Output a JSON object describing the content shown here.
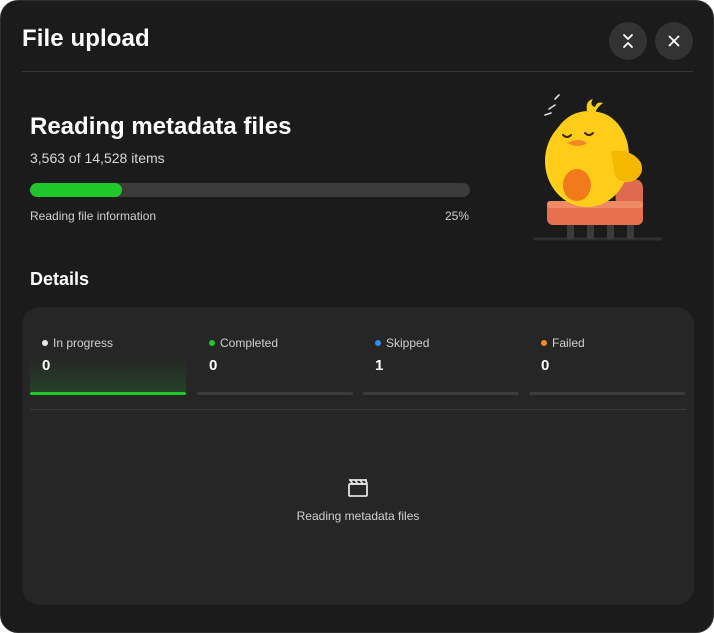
{
  "dialog": {
    "title": "File upload",
    "minimize_icon": "collapse-arrows-icon",
    "close_icon": "close-icon"
  },
  "status": {
    "heading": "Reading metadata files",
    "count_text": "3,563 of 14,528 items",
    "progress_fraction": 0.21,
    "caption": "Reading file information",
    "percent_text": "25%",
    "progress_color": "#1fc72a",
    "illustration": "sleeping-duck-on-armchair"
  },
  "details": {
    "heading": "Details",
    "tabs": [
      {
        "label": "In progress",
        "count": "0",
        "dot_color": "#e8e8e8",
        "active": true
      },
      {
        "label": "Completed",
        "count": "0",
        "dot_color": "#1fc72a",
        "active": false
      },
      {
        "label": "Skipped",
        "count": "1",
        "dot_color": "#2f8cf5",
        "active": false
      },
      {
        "label": "Failed",
        "count": "0",
        "dot_color": "#f08a24",
        "active": false
      }
    ],
    "empty_state": {
      "icon": "clapperboard-icon",
      "text": "Reading metadata files"
    }
  }
}
